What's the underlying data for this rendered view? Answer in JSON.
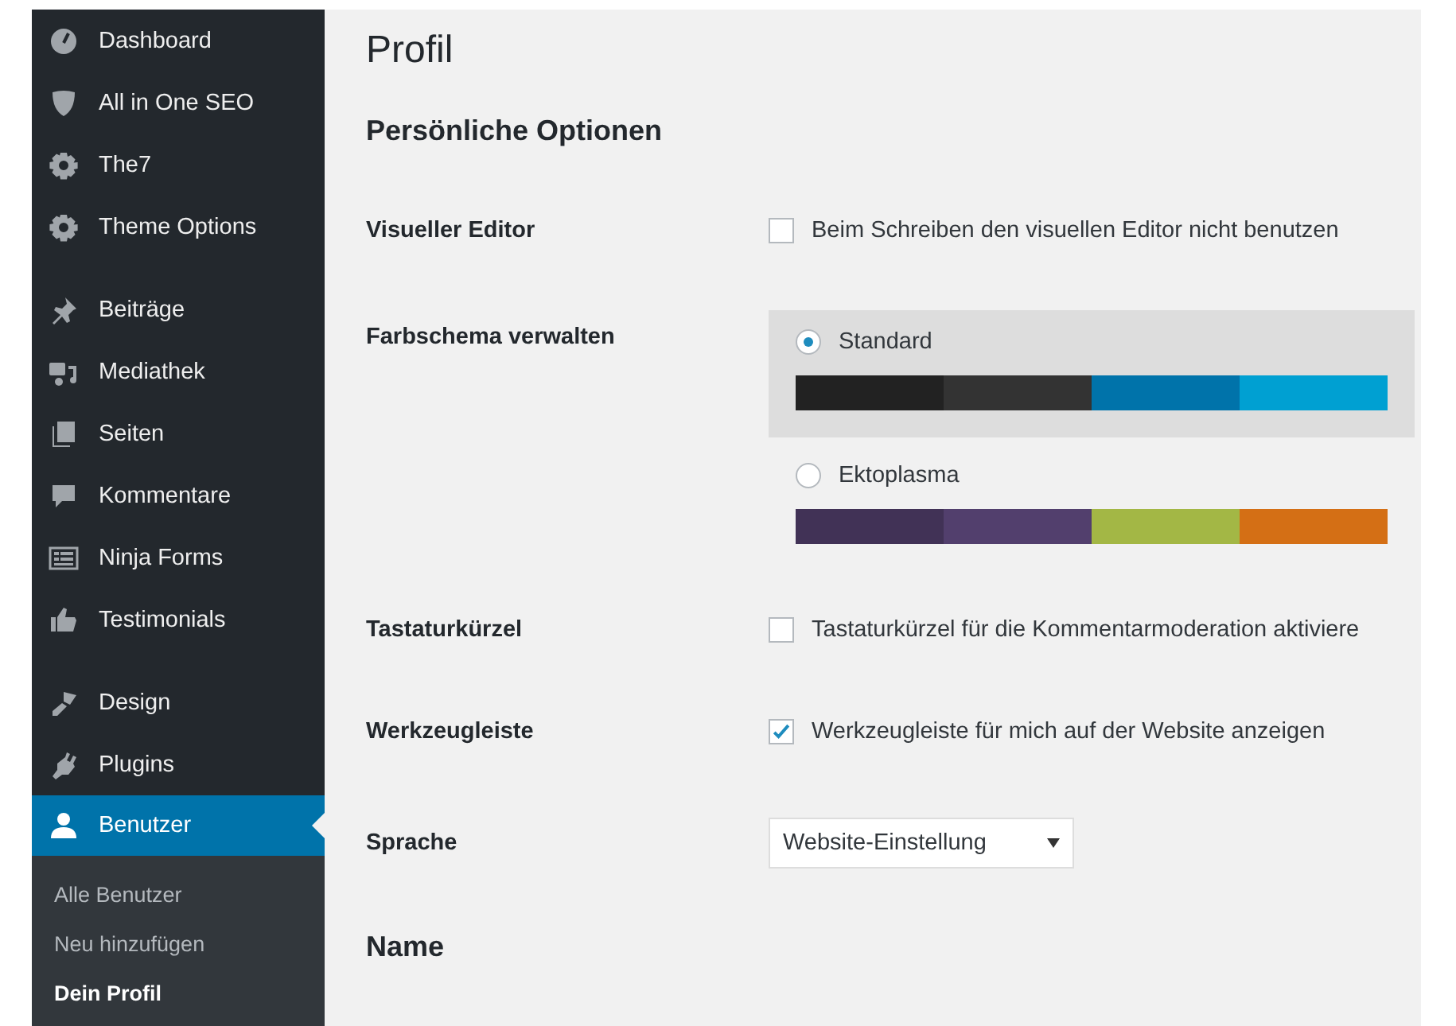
{
  "sidebar": {
    "groups": [
      {
        "items": [
          {
            "label": "Dashboard",
            "selected": false
          },
          {
            "label": "All in One SEO",
            "selected": false
          },
          {
            "label": "The7",
            "selected": false
          },
          {
            "label": "Theme Options",
            "selected": false
          }
        ]
      },
      {
        "items": [
          {
            "label": "Beiträge",
            "selected": false
          },
          {
            "label": "Mediathek",
            "selected": false
          },
          {
            "label": "Seiten",
            "selected": false
          },
          {
            "label": "Kommentare",
            "selected": false
          },
          {
            "label": "Ninja Forms",
            "selected": false
          },
          {
            "label": "Testimonials",
            "selected": false
          }
        ]
      },
      {
        "items": [
          {
            "label": "Design",
            "selected": false
          },
          {
            "label": "Plugins",
            "selected": false
          },
          {
            "label": "Benutzer",
            "selected": true,
            "children": [
              {
                "label": "Alle Benutzer",
                "selected": false
              },
              {
                "label": "Neu hinzufügen",
                "selected": false
              },
              {
                "label": "Dein Profil",
                "selected": true
              }
            ]
          }
        ]
      }
    ]
  },
  "page": {
    "title": "Profil",
    "section": "Persönliche Optionen",
    "rows": [
      {
        "kind": "checkbox",
        "label": "Visueller Editor",
        "text": "Beim Schreiben den visuellen Editor nicht benutzen",
        "checked": false
      },
      {
        "kind": "schemes",
        "label": "Farbschema verwalten",
        "schemes": [
          {
            "name": "Standard",
            "selected": true,
            "swatches": [
              {
                "color": "#222222"
              },
              {
                "color": "#333333"
              },
              {
                "color": "#0073aa"
              },
              {
                "color": "#00a0d2"
              }
            ]
          },
          {
            "name": "Ektoplasma",
            "selected": false,
            "swatches": [
              {
                "color": "#413256"
              },
              {
                "color": "#523f6d"
              },
              {
                "color": "#a3b745"
              },
              {
                "color": "#d46f15"
              }
            ]
          }
        ]
      },
      {
        "kind": "checkbox",
        "label": "Tastaturkürzel",
        "text": "Tastaturkürzel für die Kommentarmoderation aktiviere",
        "checked": false
      },
      {
        "kind": "checkbox",
        "label": "Werkzeugleiste",
        "text": "Werkzeugleiste für mich auf der Website anzeigen",
        "checked": true
      },
      {
        "kind": "select",
        "label": "Sprache",
        "value": "Website-Einstellung"
      }
    ],
    "next_section": "Name"
  }
}
